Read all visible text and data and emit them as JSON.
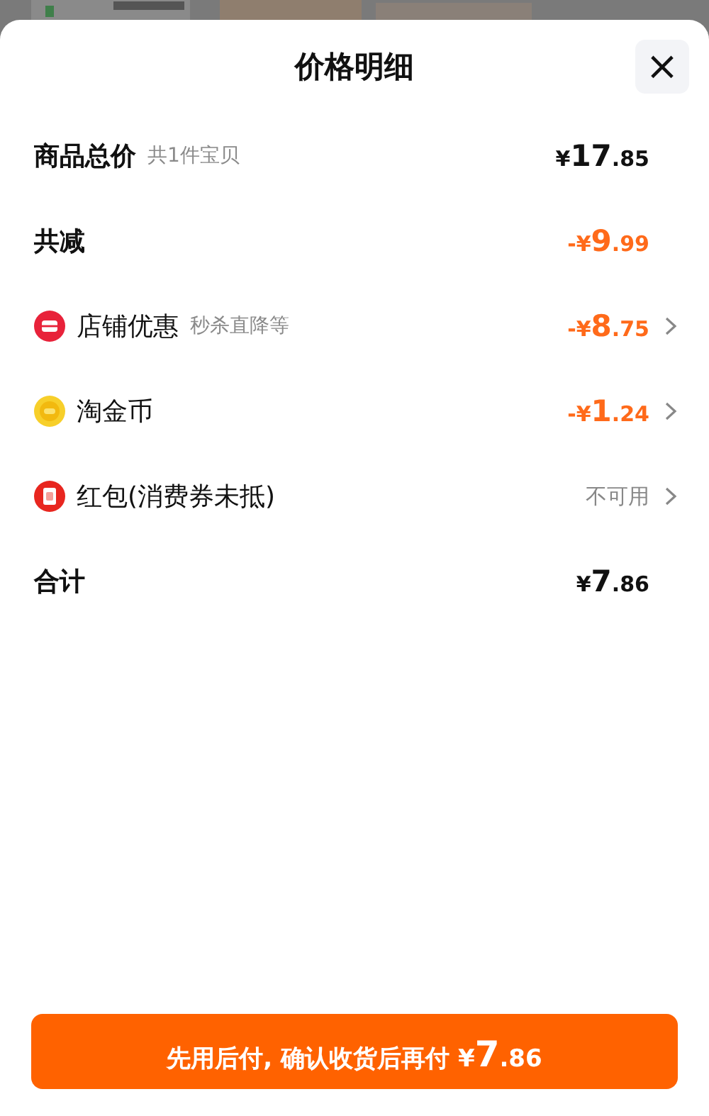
{
  "sheet": {
    "title": "价格明细",
    "close_label": "×"
  },
  "rows": [
    {
      "kind": "plain",
      "emphasis": true,
      "label": "商品总价",
      "note": "共1件宝贝",
      "amount": {
        "prefix": "¥",
        "whole": "17",
        "fraction": ".85",
        "color": "#111111"
      },
      "chevron": false
    },
    {
      "kind": "plain",
      "emphasis": true,
      "label": "共减",
      "amount": {
        "prefix": "-¥",
        "whole": "9",
        "fraction": ".99",
        "color": "#ff6a1a"
      },
      "chevron": false
    },
    {
      "kind": "shop",
      "emphasis": false,
      "label": "店铺优惠",
      "note": "秒杀直降等",
      "amount": {
        "prefix": "-¥",
        "whole": "8",
        "fraction": ".75",
        "color": "#ff6a1a"
      },
      "chevron": true
    },
    {
      "kind": "coin",
      "emphasis": false,
      "label": "淘金币",
      "amount": {
        "prefix": "-¥",
        "whole": "1",
        "fraction": ".24",
        "color": "#ff6a1a"
      },
      "chevron": true
    },
    {
      "kind": "redpacket",
      "emphasis": false,
      "label": "红包(消费券未抵)",
      "status": "不可用",
      "chevron": true
    },
    {
      "kind": "plain",
      "emphasis": true,
      "label": "合计",
      "amount": {
        "prefix": "¥",
        "whole": "7",
        "fraction": ".86",
        "color": "#111111"
      },
      "chevron": false
    }
  ],
  "pay_button": {
    "label": "先用后付, 确认收货后再付",
    "amount": {
      "prefix": "¥",
      "whole": "7",
      "fraction": ".86"
    }
  }
}
